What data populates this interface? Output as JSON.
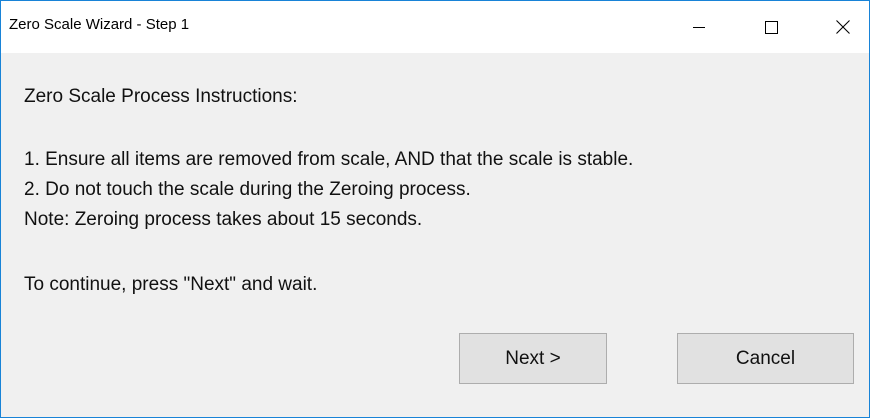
{
  "window": {
    "title": "Zero Scale Wizard - Step 1",
    "controls": {
      "minimize": "minimize-icon",
      "maximize": "maximize-icon",
      "close": "close-icon"
    },
    "accent_border": "#1883d7"
  },
  "instructions": {
    "heading": "Zero Scale Process Instructions:",
    "step1": "1. Ensure all items are removed from scale, AND that the scale is stable.",
    "step2": "2. Do not touch the scale during the Zeroing process.",
    "note": "Note: Zeroing process takes about 15 seconds.",
    "continue_text": "To continue, press \"Next\" and wait."
  },
  "buttons": {
    "next_label": "Next >",
    "cancel_label": "Cancel"
  }
}
